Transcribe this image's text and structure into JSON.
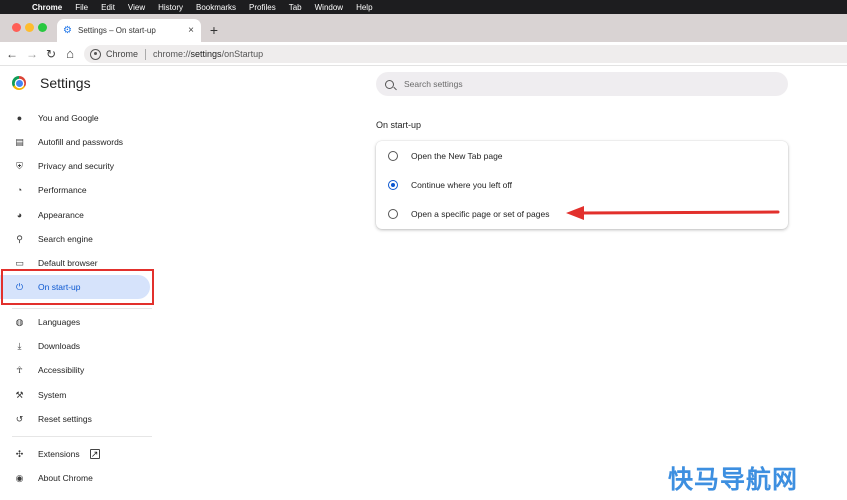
{
  "menubar": {
    "apple_icon": "apple-icon",
    "items": [
      "Chrome",
      "File",
      "Edit",
      "View",
      "History",
      "Bookmarks",
      "Profiles",
      "Tab",
      "Window",
      "Help"
    ]
  },
  "tab": {
    "title": "Settings – On start-up",
    "favicon": "gear-icon",
    "close": "×",
    "new_tab": "+"
  },
  "toolbar": {
    "back": "←",
    "forward": "→",
    "reload": "↻",
    "home": "⌂",
    "chip_label": "Chrome",
    "url_prefix": "chrome://",
    "url_host": "settings",
    "url_path": "/onStartup"
  },
  "header": {
    "title": "Settings",
    "search_placeholder": "Search settings"
  },
  "sidebar": {
    "items": [
      {
        "label": "You and Google",
        "icon": "person-icon",
        "glyph": "👤"
      },
      {
        "label": "Autofill and passwords",
        "icon": "clipboard-icon",
        "glyph": "📋"
      },
      {
        "label": "Privacy and security",
        "icon": "shield-icon",
        "glyph": "⛨"
      },
      {
        "label": "Performance",
        "icon": "speedometer-icon",
        "glyph": "◔"
      },
      {
        "label": "Appearance",
        "icon": "palette-icon",
        "glyph": "🎨"
      },
      {
        "label": "Search engine",
        "icon": "search-icon",
        "glyph": "⌕"
      },
      {
        "label": "Default browser",
        "icon": "browser-icon",
        "glyph": "▭"
      },
      {
        "label": "On start-up",
        "icon": "power-icon",
        "glyph": "⏻",
        "active": true
      },
      {
        "label": "Languages",
        "icon": "globe-icon",
        "glyph": "🌐"
      },
      {
        "label": "Downloads",
        "icon": "download-icon",
        "glyph": "⤓"
      },
      {
        "label": "Accessibility",
        "icon": "accessibility-icon",
        "glyph": "♿"
      },
      {
        "label": "System",
        "icon": "wrench-icon",
        "glyph": "🔧"
      },
      {
        "label": "Reset settings",
        "icon": "reset-icon",
        "glyph": "↺"
      },
      {
        "label": "Extensions",
        "icon": "puzzle-icon",
        "glyph": "🧩",
        "external_icon": "external-link-icon",
        "external_glyph": "↗"
      },
      {
        "label": "About Chrome",
        "icon": "chrome-icon",
        "glyph": "◉"
      }
    ]
  },
  "main": {
    "section_title": "On start-up",
    "options": [
      {
        "label": "Open the New Tab page",
        "checked": false
      },
      {
        "label": "Continue where you left off",
        "checked": true
      },
      {
        "label": "Open a specific page or set of pages",
        "checked": false
      }
    ]
  },
  "annotations": {
    "highlight_color": "#e2302c",
    "arrow_color": "#e2302c"
  },
  "watermark": "快马导航网",
  "colors": {
    "accent": "#0b57d0",
    "active_bg": "#d6e3fb"
  }
}
